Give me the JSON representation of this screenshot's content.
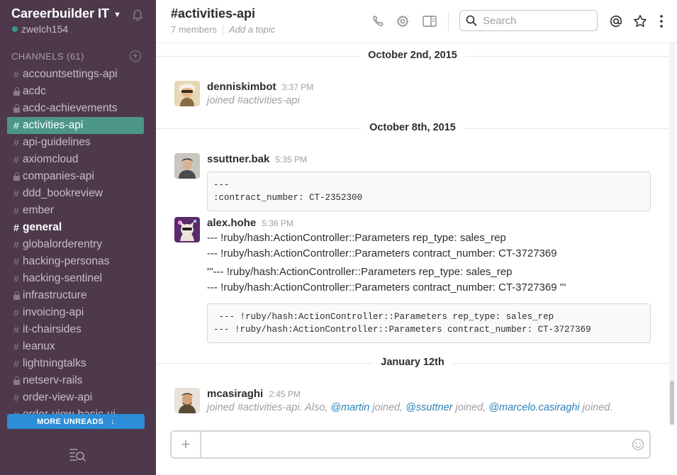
{
  "team": {
    "name": "Careerbuilder IT",
    "user": "zwelch154"
  },
  "sidebar": {
    "channels_label": "CHANNELS",
    "channels_count": "(61)",
    "channels": [
      {
        "prefix": "#",
        "name": "accountsettings-api",
        "private": false,
        "state": "normal"
      },
      {
        "prefix": "lock",
        "name": "acdc",
        "private": true,
        "state": "normal"
      },
      {
        "prefix": "lock",
        "name": "acdc-achievements",
        "private": true,
        "state": "normal"
      },
      {
        "prefix": "#",
        "name": "activities-api",
        "private": false,
        "state": "active"
      },
      {
        "prefix": "#",
        "name": "api-guidelines",
        "private": false,
        "state": "normal"
      },
      {
        "prefix": "#",
        "name": "axiomcloud",
        "private": false,
        "state": "normal"
      },
      {
        "prefix": "lock",
        "name": "companies-api",
        "private": true,
        "state": "normal"
      },
      {
        "prefix": "#",
        "name": "ddd_bookreview",
        "private": false,
        "state": "normal"
      },
      {
        "prefix": "#",
        "name": "ember",
        "private": false,
        "state": "normal"
      },
      {
        "prefix": "#",
        "name": "general",
        "private": false,
        "state": "bold"
      },
      {
        "prefix": "#",
        "name": "globalorderentry",
        "private": false,
        "state": "normal"
      },
      {
        "prefix": "#",
        "name": "hacking-personas",
        "private": false,
        "state": "normal"
      },
      {
        "prefix": "#",
        "name": "hacking-sentinel",
        "private": false,
        "state": "normal"
      },
      {
        "prefix": "lock",
        "name": "infrastructure",
        "private": true,
        "state": "normal"
      },
      {
        "prefix": "#",
        "name": "invoicing-api",
        "private": false,
        "state": "normal"
      },
      {
        "prefix": "#",
        "name": "it-chairsides",
        "private": false,
        "state": "normal"
      },
      {
        "prefix": "#",
        "name": "leanux",
        "private": false,
        "state": "normal"
      },
      {
        "prefix": "#",
        "name": "lightningtalks",
        "private": false,
        "state": "normal"
      },
      {
        "prefix": "lock",
        "name": "netserv-rails",
        "private": true,
        "state": "normal"
      },
      {
        "prefix": "#",
        "name": "order-view-api",
        "private": false,
        "state": "normal"
      },
      {
        "prefix": "#",
        "name": "order-view-basic-ui",
        "private": false,
        "state": "normal"
      }
    ],
    "more_unreads": "MORE UNREADS"
  },
  "header": {
    "title": "#activities-api",
    "members": "7 members",
    "topic_placeholder": "Add a topic",
    "search_placeholder": "Search"
  },
  "messages": {
    "day1": "October 2nd, 2015",
    "msg1": {
      "user": "denniskimbot",
      "time": "3:37 PM",
      "text": "joined #activities-api"
    },
    "day2": "October 8th, 2015",
    "msg2": {
      "user": "ssuttner.bak",
      "time": "5:35 PM",
      "code": "---\n:contract_number: CT-2352300"
    },
    "msg3": {
      "user": "alex.hohe",
      "time": "5:36 PM",
      "line1": "--- !ruby/hash:ActionController::Parameters rep_type: sales_rep",
      "line2": "--- !ruby/hash:ActionController::Parameters contract_number: CT-3727369",
      "line3": "'''--- !ruby/hash:ActionController::Parameters rep_type: sales_rep",
      "line4": "--- !ruby/hash:ActionController::Parameters contract_number: CT-3727369 '''",
      "code": " --- !ruby/hash:ActionController::Parameters rep_type: sales_rep\n--- !ruby/hash:ActionController::Parameters contract_number: CT-3727369"
    },
    "day3": "January 12th",
    "msg4": {
      "user": "mcasiraghi",
      "time": "2:45 PM",
      "joined_text": "joined #activities-api. Also, ",
      "mention1": "@martin",
      "mid1": " joined, ",
      "mention2": "@ssuttner",
      "mid2": " joined, ",
      "mention3": "@marcelo.casiraghi",
      "end": " joined."
    }
  },
  "colors": {
    "sidebar_bg": "#4d394b",
    "active_channel": "#4c9689",
    "presence": "#38978d",
    "more_unreads_bg": "#2d8dd6",
    "mention": "#2a80b9",
    "notification": "#eb4d5c"
  }
}
